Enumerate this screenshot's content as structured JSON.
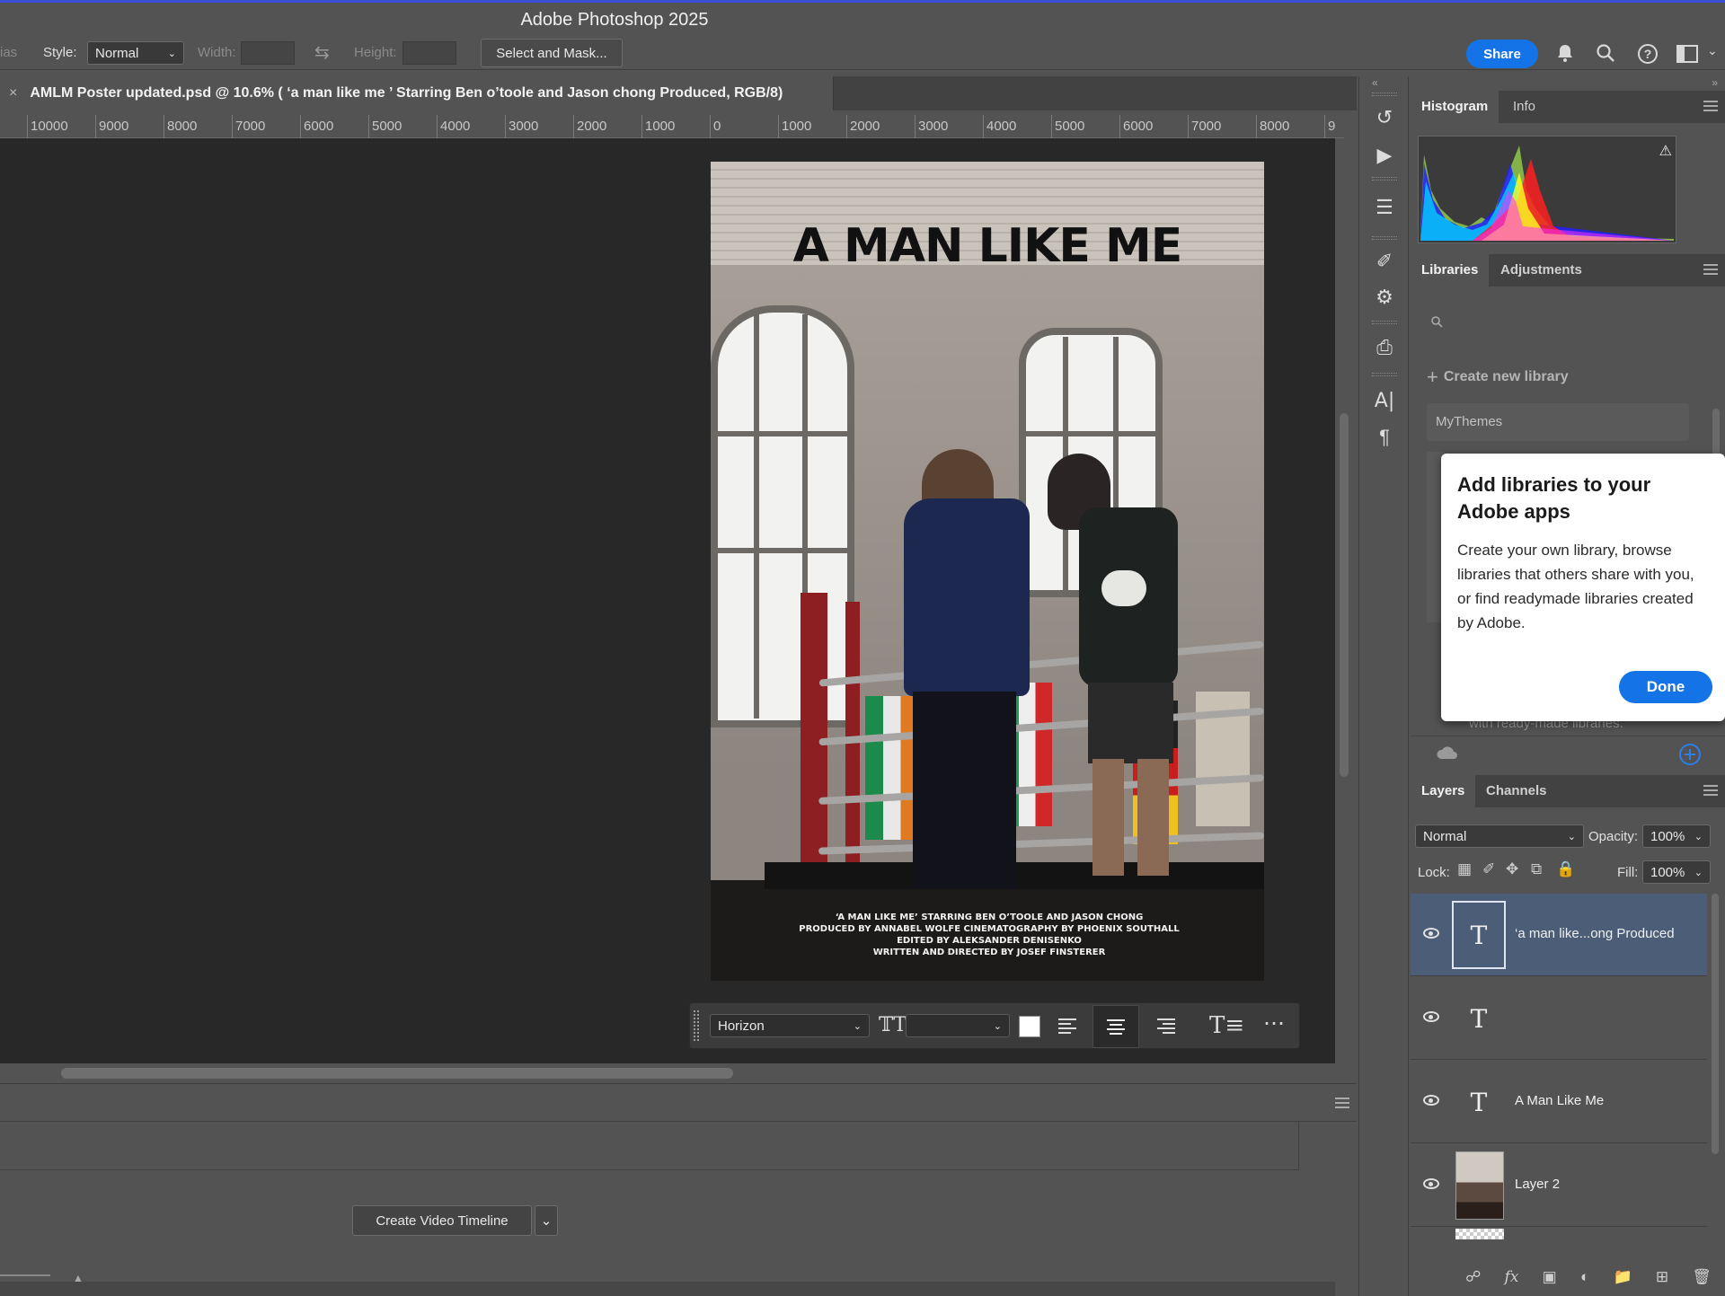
{
  "window": {
    "title": "Adobe Photoshop 2025"
  },
  "options_bar": {
    "cut_label": "ias",
    "style_label": "Style:",
    "style_value": "Normal",
    "width_label": "Width:",
    "height_label": "Height:",
    "select_mask_label": "Select and Mask...",
    "share_label": "Share"
  },
  "document": {
    "tab_title": "AMLM Poster updated.psd @ 10.6% ( ‘a man like me ’ Starring Ben o’toole and Jason chong Produced, RGB/8)",
    "zoom_percent": 10.6
  },
  "ruler": {
    "ticks": [
      "10000",
      "9000",
      "8000",
      "7000",
      "6000",
      "5000",
      "4000",
      "3000",
      "2000",
      "1000",
      "0",
      "1000",
      "2000",
      "3000",
      "4000",
      "5000",
      "6000",
      "7000",
      "8000",
      "9"
    ]
  },
  "poster": {
    "title": "A MAN LIKE ME",
    "credits": [
      "‘A MAN LIKE ME’ STARRING BEN O’TOOLE AND JASON CHONG",
      "PRODUCED BY ANNABEL WOLFE CINEMATOGRAPHY BY PHOENIX SOUTHALL",
      "EDITED BY ALEKSANDER DENISENKO",
      "WRITTEN AND DIRECTED BY JOSEF FINSTERER"
    ]
  },
  "text_toolbar": {
    "font_family": "Horizon",
    "font_size": "",
    "color": "#ffffff"
  },
  "timeline": {
    "create_label": "Create Video Timeline"
  },
  "histogram_panel": {
    "tabs": [
      "Histogram",
      "Info"
    ]
  },
  "libraries_panel": {
    "tabs": [
      "Libraries",
      "Adjustments"
    ],
    "create_label": "Create new library",
    "library_item": "MyThemes",
    "hidden_text": "with ready-made libraries."
  },
  "popover": {
    "heading": "Add libraries to your Adobe apps",
    "body": "Create your own library, browse libraries that others share with you, or find readymade libraries created by Adobe.",
    "done_label": "Done"
  },
  "layers_panel": {
    "tabs": [
      "Layers",
      "Channels"
    ],
    "blend_mode": "Normal",
    "opacity_label": "Opacity:",
    "opacity_value": "100%",
    "lock_label": "Lock:",
    "fill_label": "Fill:",
    "fill_value": "100%",
    "layers": [
      {
        "name": "‘a man like...ong Produced",
        "type": "text",
        "selected": true
      },
      {
        "name": "",
        "type": "text",
        "selected": false
      },
      {
        "name": "A Man Like Me",
        "type": "text",
        "selected": false
      },
      {
        "name": "Layer 2",
        "type": "image",
        "selected": false
      }
    ]
  },
  "colors": {
    "accent": "#1473e6",
    "selected_layer": "#4b5d77",
    "canvas_bg": "#282828"
  }
}
